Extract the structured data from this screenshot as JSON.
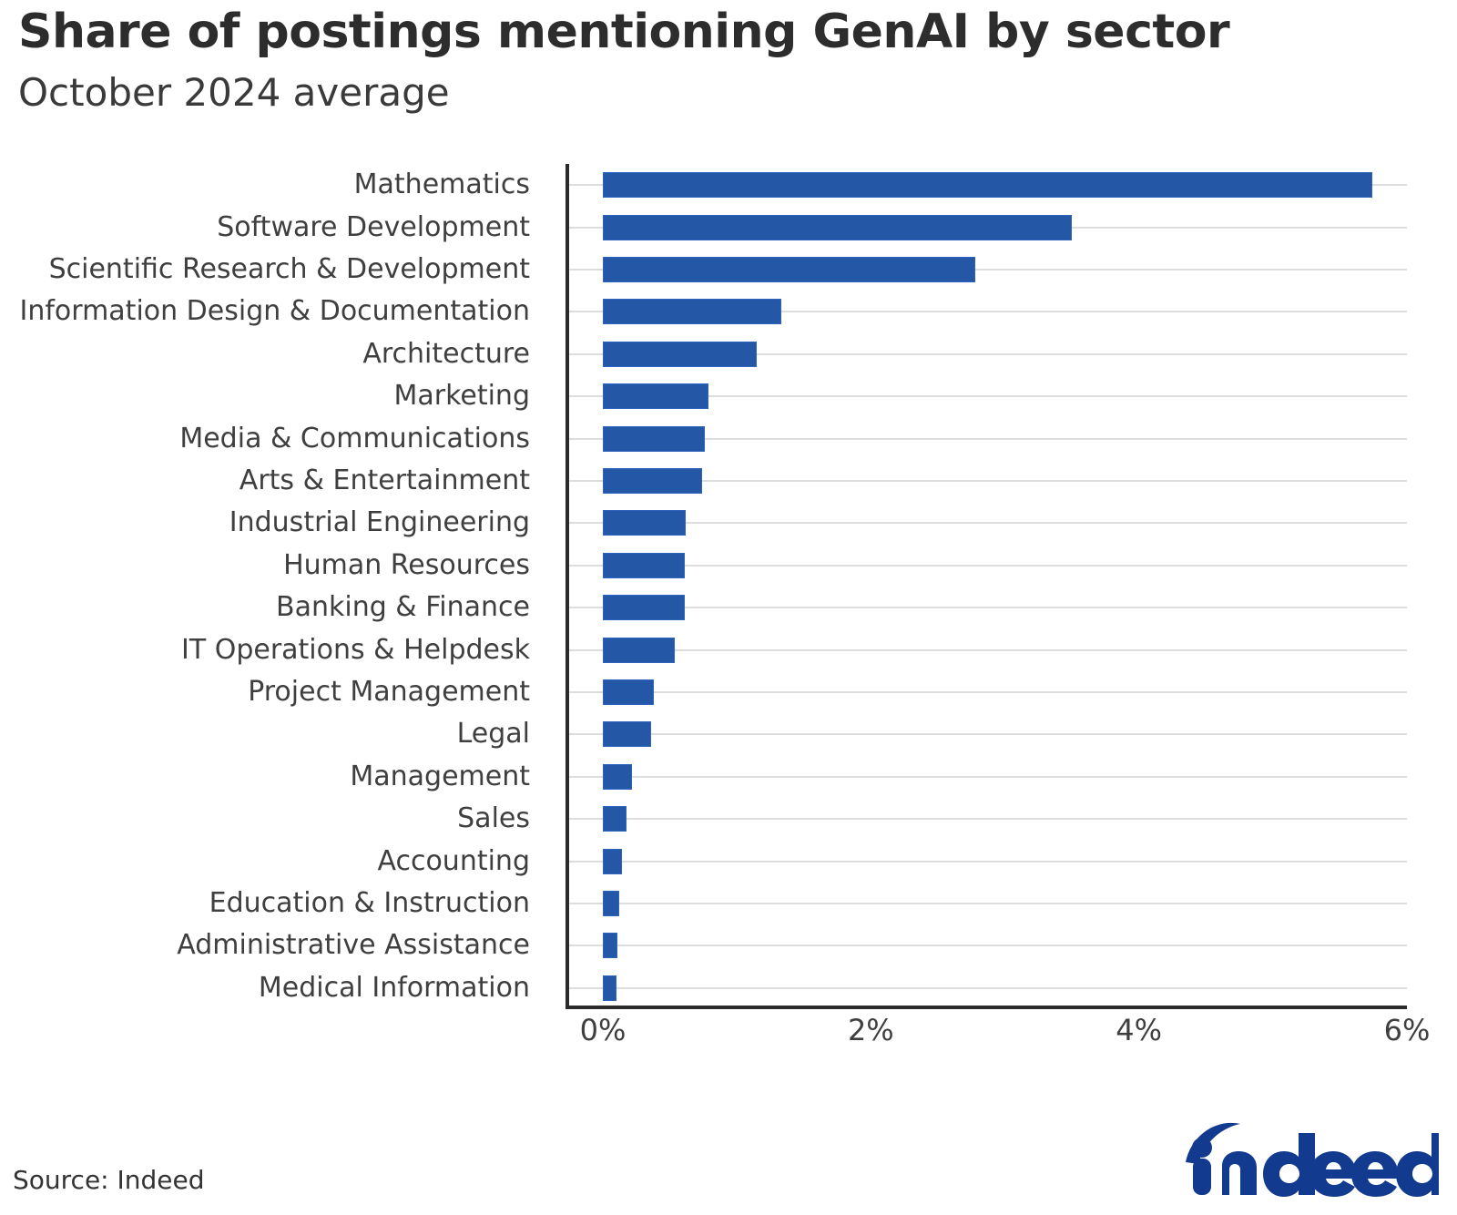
{
  "header": {
    "title": "Share of postings mentioning GenAI by sector",
    "subtitle": "October 2024 average"
  },
  "footer": {
    "source": "Source: Indeed",
    "logo_alt": "indeed"
  },
  "chart_data": {
    "type": "bar",
    "orientation": "horizontal",
    "title": "Share of postings mentioning GenAI by sector",
    "subtitle": "October 2024 average",
    "xlabel": "",
    "ylabel": "",
    "xlim": [
      0,
      6
    ],
    "xticks": [
      0,
      2,
      4,
      6
    ],
    "xtick_labels": [
      "0%",
      "2%",
      "4%",
      "6%"
    ],
    "grid": true,
    "grid_axis": "x-rows",
    "legend": false,
    "bar_color": "#2557a7",
    "categories": [
      "Mathematics",
      "Software Development",
      "Scientific Research & Development",
      "Information Design & Documentation",
      "Architecture",
      "Marketing",
      "Media & Communications",
      "Arts & Entertainment",
      "Industrial Engineering",
      "Human Resources",
      "Banking & Finance",
      "IT Operations & Helpdesk",
      "Project Management",
      "Legal",
      "Management",
      "Sales",
      "Accounting",
      "Education & Instruction",
      "Administrative Assistance",
      "Medical Information"
    ],
    "values": [
      5.74,
      3.5,
      2.78,
      1.33,
      1.15,
      0.79,
      0.76,
      0.74,
      0.62,
      0.61,
      0.61,
      0.54,
      0.38,
      0.36,
      0.22,
      0.18,
      0.14,
      0.12,
      0.11,
      0.1
    ],
    "value_unit": "%"
  }
}
